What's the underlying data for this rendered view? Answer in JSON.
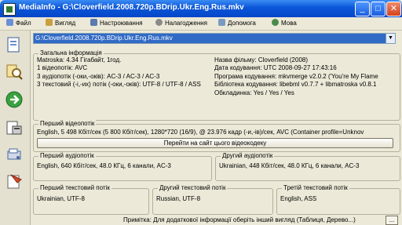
{
  "window": {
    "title": "MediaInfo - G:\\Cloverfield.2008.720p.BDrip.Ukr.Eng.Rus.mkv",
    "minimize": "_",
    "maximize": "□",
    "close": "✕"
  },
  "menu": [
    {
      "label": "Файл",
      "icon": "file-icon",
      "color": "#6b8fd6"
    },
    {
      "label": "Вигляд",
      "icon": "view-icon",
      "color": "#c8a040"
    },
    {
      "label": "Настроювання",
      "icon": "settings-icon",
      "color": "#5a7ab0"
    },
    {
      "label": "Налагодження",
      "icon": "debug-icon",
      "color": "#8a8a8a"
    },
    {
      "label": "Допомога",
      "icon": "help-icon",
      "color": "#7a9ac0"
    },
    {
      "label": "Мова",
      "icon": "language-icon",
      "color": "#4a8a4a"
    }
  ],
  "file_selector": {
    "value": "G:\\Cloverfield.2008.720p.BDrip.Ukr.Eng.Rus.mkv"
  },
  "general": {
    "legend": "Загальна інформація",
    "left_lines": [
      "Matroska: 4.34 Гігабайт, 1год.",
      "1 відеопотік: AVC",
      "3 аудіопотік (-оки,-оків): AC-3 / AC-3 / AC-3",
      "3 текстовий (-і,-их) потік (-оки,-оків): UTF-8 / UTF-8 / ASS"
    ],
    "right_lines": [
      "Назва фільму: Cloverfield (2008)",
      "Дата кодування: UTC 2008-09-27 17:43:16",
      "Програма кодування: mkvmerge v2.0.2 ('You're My Flame",
      "Бібліотека кодування: libebml v0.7.7 + libmatroska v0.8.1",
      "Обкладинка: Yes / Yes / Yes"
    ]
  },
  "video": {
    "legend": "Перший відеопотік",
    "info": "English, 5 498 Кбіт/сек (5 800 Кбіт/сек), 1280*720 (16/9), @ 23.976 кадр (-и,-ів)/сек, AVC (Container profile=Unknov",
    "site_button": "Перейти на сайт цього відеокодеку"
  },
  "audio": [
    {
      "legend": "Перший аудіопотік",
      "info": "English, 640 Кбіт/сек, 48.0 КГц, 6 канали, AC-3"
    },
    {
      "legend": "Другий аудіопотік",
      "info": "Ukrainian, 448 Кбіт/сек, 48.0 КГц, 6 канали, AC-3"
    }
  ],
  "text": [
    {
      "legend": "Перший текстовий потік",
      "info": "Ukrainian, UTF-8"
    },
    {
      "legend": "Другий текстовий потік",
      "info": "Russian, UTF-8"
    },
    {
      "legend": "Третій текстовий потік",
      "info": "English, ASS"
    }
  ],
  "status": {
    "note": "Примітка: Для додаткової інформації оберіть інший вигляд (Таблиця, Дерево...)",
    "more_button": "..."
  },
  "sidebar": [
    {
      "name": "open-file-icon",
      "color": "#6a8cc8"
    },
    {
      "name": "search-icon",
      "color": "#d8a030"
    },
    {
      "name": "next-icon",
      "color": "#3aa040"
    },
    {
      "name": "export-icon",
      "color": "#6a6a6a"
    },
    {
      "name": "options-icon",
      "color": "#4a6a9a"
    },
    {
      "name": "report-icon",
      "color": "#c04a2a"
    }
  ]
}
